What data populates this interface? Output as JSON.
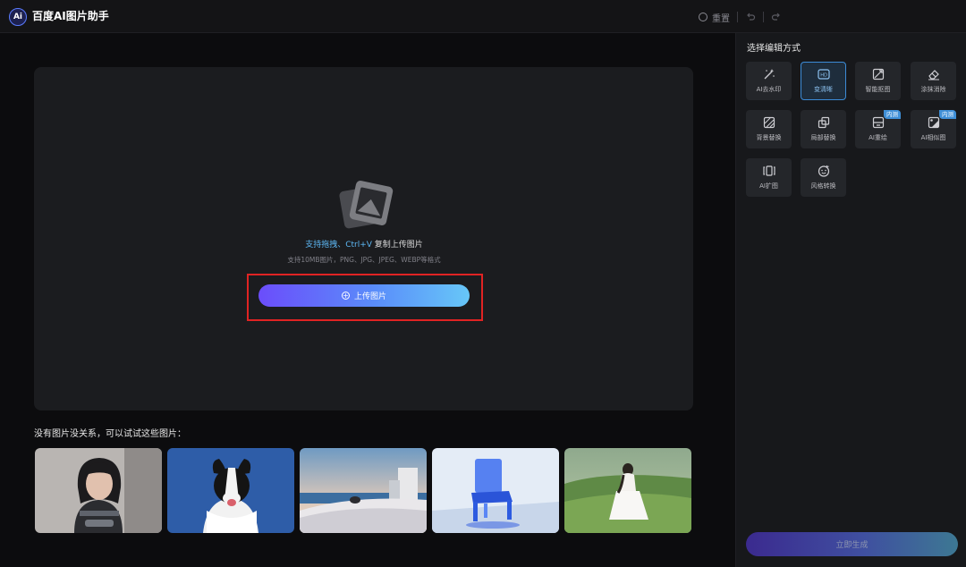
{
  "app": {
    "logo_text": "Ai",
    "title": "百度AI图片助手"
  },
  "toolbar": {
    "reset_label": "重置",
    "undo_icon": "undo-icon",
    "redo_icon": "redo-icon"
  },
  "upload": {
    "hint_highlight": "支持拖拽、Ctrl+V",
    "hint_rest": " 复制上传图片",
    "formats": "支持10MB图片，PNG、JPG、JPEG、WEBP等格式",
    "button_label": "上传图片"
  },
  "samples": {
    "title": "没有图片没关系，可以试试这些图片：",
    "items": [
      "portrait-sample",
      "dog-sample",
      "seaside-building-sample",
      "glass-chair-sample",
      "meadow-girl-sample"
    ]
  },
  "panel": {
    "title": "选择编辑方式",
    "tools": [
      {
        "label": "AI去水印",
        "icon": "magic-wand-icon",
        "active": false,
        "badge": ""
      },
      {
        "label": "变清晰",
        "icon": "hd-icon",
        "active": true,
        "badge": ""
      },
      {
        "label": "智能抠图",
        "icon": "cutout-icon",
        "active": false,
        "badge": ""
      },
      {
        "label": "涂抹消除",
        "icon": "eraser-icon",
        "active": false,
        "badge": ""
      },
      {
        "label": "背景替换",
        "icon": "background-icon",
        "active": false,
        "badge": ""
      },
      {
        "label": "局部替换",
        "icon": "partial-replace-icon",
        "active": false,
        "badge": ""
      },
      {
        "label": "AI重绘",
        "icon": "redraw-icon",
        "active": false,
        "badge": "内测"
      },
      {
        "label": "AI相似图",
        "icon": "similar-image-icon",
        "active": false,
        "badge": "内测"
      },
      {
        "label": "AI扩图",
        "icon": "expand-icon",
        "active": false,
        "badge": ""
      },
      {
        "label": "风格转换",
        "icon": "style-transfer-icon",
        "active": false,
        "badge": ""
      }
    ],
    "generate_label": "立即生成"
  },
  "colors": {
    "accent": "#5a8dfa",
    "highlight_text": "#5db8f5",
    "highlight_frame": "#e02323",
    "badge": "#3f8fd7"
  }
}
